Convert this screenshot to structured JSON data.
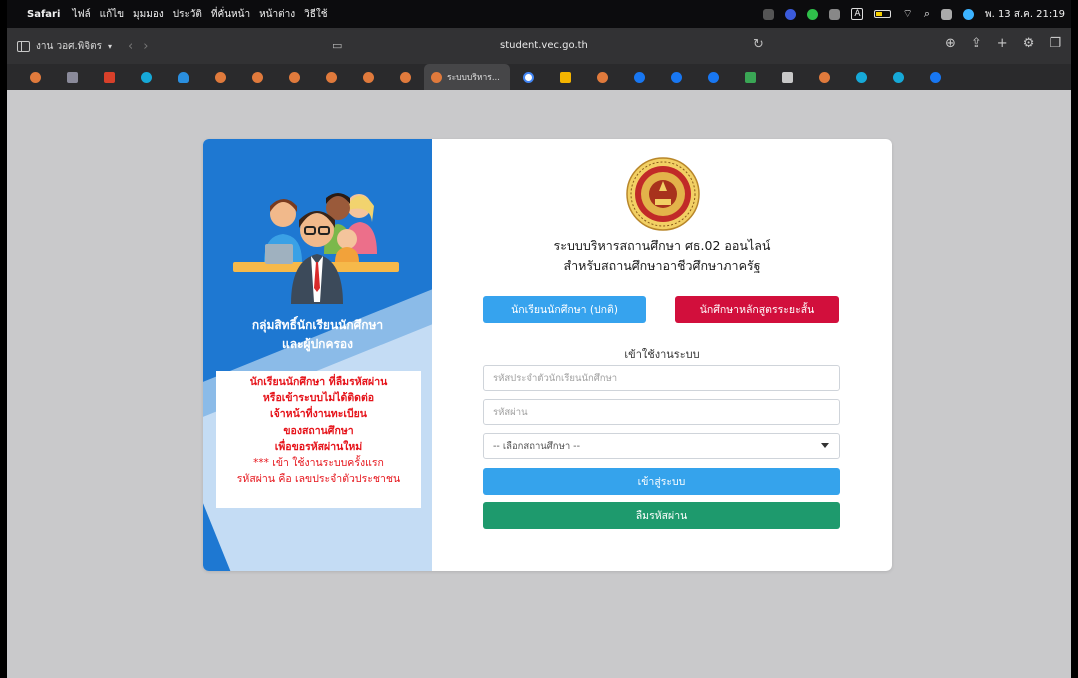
{
  "menubar": {
    "items": [
      "Safari",
      "ไฟล์",
      "แก้ไข",
      "มุมมอง",
      "ประวัติ",
      "ที่คั่นหน้า",
      "หน้าต่าง",
      "วิธีใช้"
    ],
    "clock": "พ. 13 ส.ค. 21:19",
    "tray_text": "A"
  },
  "toolbar": {
    "group_label": "งาน วอศ.พิจิตร",
    "url": "student.vec.go.th"
  },
  "tabs": {
    "active_title": "ระบบบริหาร..."
  },
  "left_panel": {
    "group_title": [
      "กลุ่มสิทธิ์นักเรียนนักศึกษา",
      "และผู้ปกครอง"
    ],
    "notice_red": [
      "นักเรียนนักศึกษา ที่ลืมรหัสผ่าน",
      "หรือเข้าระบบไม่ได้ติดต่อ",
      "เจ้าหน้าที่งานทะเบียน",
      "ของสถานศึกษา",
      "เพื่อขอรหัสผ่านใหม่"
    ],
    "notice_first": [
      "*** เข้า ใช้งานระบบครั้งแรก",
      "รหัสผ่าน คือ เลขประจำตัวประชาชน"
    ]
  },
  "form": {
    "title_line1": "ระบบบริหารสถานศึกษา ศธ.02 ออนไลน์",
    "title_line2": "สำหรับสถานศึกษาอาชีวศึกษาภาครัฐ",
    "btn_student": "นักเรียนนักศึกษา (ปกติ)",
    "btn_short": "นักศึกษาหลักสูตรระยะสั้น",
    "login_heading": "เข้าใช้งานระบบ",
    "student_id_placeholder": "รหัสประจำตัวนักเรียนนักศึกษา",
    "password_placeholder": "รหัสผ่าน",
    "institution_select": "-- เลือกสถานศึกษา --",
    "btn_login": "เข้าสู่ระบบ",
    "btn_forgot": "ลืมรหัสผ่าน"
  },
  "colors": {
    "panel_blue": "#1e78d2",
    "btn_blue": "#36a3ee",
    "btn_red": "#d20f3c",
    "btn_green": "#1e9a6d",
    "notice_red": "#e6141b"
  }
}
